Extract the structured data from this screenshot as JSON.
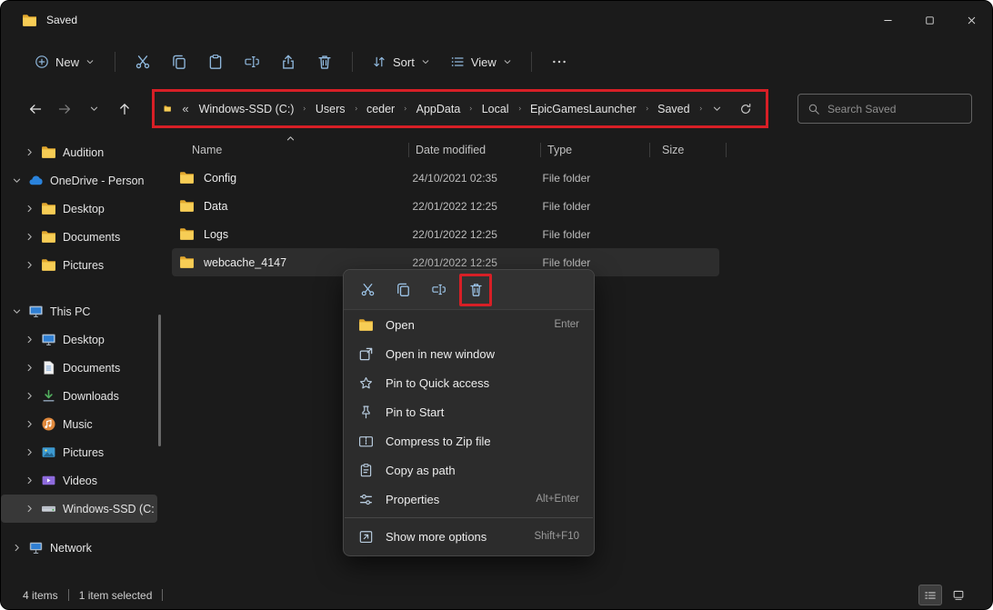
{
  "window": {
    "title": "Saved"
  },
  "toolbar": {
    "new_label": "New",
    "sort_label": "Sort",
    "view_label": "View",
    "icons": [
      "cut-icon",
      "copy-icon",
      "paste-icon",
      "rename-icon",
      "share-icon",
      "delete-icon",
      "more-icon"
    ]
  },
  "addressbar": {
    "overflow": "«",
    "crumbs": [
      "Windows-SSD (C:)",
      "Users",
      "ceder",
      "AppData",
      "Local",
      "EpicGamesLauncher",
      "Saved"
    ],
    "search_placeholder": "Search Saved"
  },
  "sidebar": {
    "items": [
      {
        "label": "Audition",
        "icon": "folder-icon"
      },
      {
        "label": "OneDrive - Person",
        "icon": "onedrive-cloud-icon"
      },
      {
        "label": "Desktop",
        "icon": "folder-icon"
      },
      {
        "label": "Documents",
        "icon": "folder-icon"
      },
      {
        "label": "Pictures",
        "icon": "folder-icon"
      },
      {
        "label": "This PC",
        "icon": "this-pc-icon"
      },
      {
        "label": "Desktop",
        "icon": "monitor-icon"
      },
      {
        "label": "Documents",
        "icon": "document-icon"
      },
      {
        "label": "Downloads",
        "icon": "download-icon"
      },
      {
        "label": "Music",
        "icon": "music-icon"
      },
      {
        "label": "Pictures",
        "icon": "picture-icon"
      },
      {
        "label": "Videos",
        "icon": "video-icon"
      },
      {
        "label": "Windows-SSD (C:",
        "icon": "drive-icon",
        "selected": true
      },
      {
        "label": "Network",
        "icon": "network-icon"
      }
    ]
  },
  "filelist": {
    "columns": {
      "name": "Name",
      "date": "Date modified",
      "type": "Type",
      "size": "Size"
    },
    "rows": [
      {
        "name": "Config",
        "date": "24/10/2021 02:35",
        "type": "File folder",
        "size": ""
      },
      {
        "name": "Data",
        "date": "22/01/2022 12:25",
        "type": "File folder",
        "size": ""
      },
      {
        "name": "Logs",
        "date": "22/01/2022 12:25",
        "type": "File folder",
        "size": ""
      },
      {
        "name": "webcache_4147",
        "date": "22/01/2022 12:25",
        "type": "File folder",
        "size": "",
        "selected": true
      }
    ]
  },
  "context_menu": {
    "quick_icons": [
      "cut-icon",
      "copy-icon",
      "rename-icon",
      "delete-icon"
    ],
    "items": [
      {
        "label": "Open",
        "shortcut": "Enter",
        "icon": "folder-open-icon"
      },
      {
        "label": "Open in new window",
        "shortcut": "",
        "icon": "new-window-icon"
      },
      {
        "label": "Pin to Quick access",
        "shortcut": "",
        "icon": "star-icon"
      },
      {
        "label": "Pin to Start",
        "shortcut": "",
        "icon": "pin-icon"
      },
      {
        "label": "Compress to Zip file",
        "shortcut": "",
        "icon": "zip-icon"
      },
      {
        "label": "Copy as path",
        "shortcut": "",
        "icon": "copy-path-icon"
      },
      {
        "label": "Properties",
        "shortcut": "Alt+Enter",
        "icon": "properties-icon"
      },
      {
        "label": "Show more options",
        "shortcut": "Shift+F10",
        "icon": "show-more-icon"
      }
    ]
  },
  "statusbar": {
    "count": "4 items",
    "selected": "1 item selected"
  },
  "colors": {
    "annotation_red": "#d71f26",
    "folder_yellow": "#f7cd55",
    "selection_gray": "#2d2d2d"
  }
}
